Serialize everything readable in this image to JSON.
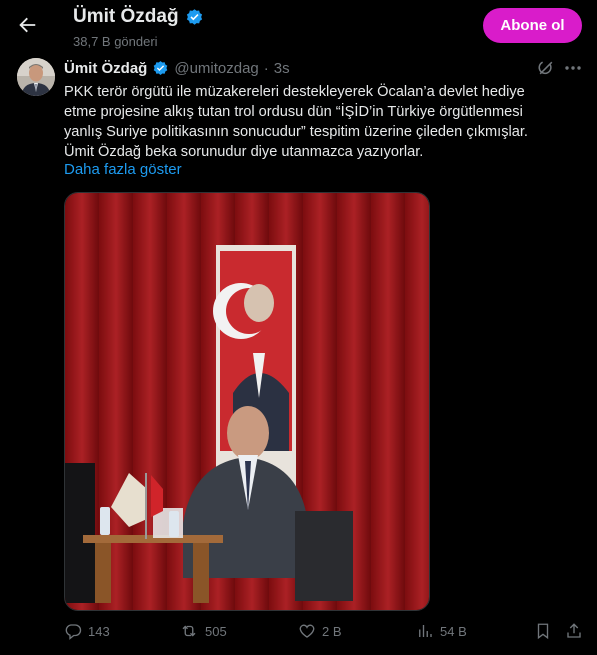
{
  "header": {
    "title": "Ümit Özdağ",
    "subtitle": "38,7 B gönderi",
    "follow_label": "Abone ol"
  },
  "tweet": {
    "author_name": "Ümit Özdağ",
    "handle": "@umitozdag",
    "separator": "·",
    "time": "3s",
    "text": "PKK terör örgütü ile müzakereleri destekleyerek Öcalan’a devlet hediye\netme projesine alkış tutan trol ordusu dün “İŞİD’in Türkiye örgütlenmesi\nyanlış Suriye politikasının sonucudur”  tespitim üzerine çileden çıkmışlar.\nÜmit Özdağ beka sorunudur diye utanmazca yazıyorlar.",
    "show_more": "Daha fazla göster"
  },
  "metrics": {
    "replies": "143",
    "reposts": "505",
    "likes": "2 B",
    "views": "54 B"
  },
  "colors": {
    "accent": "#1d9bf0",
    "follow_button": "#d91cca",
    "muted": "#71767b",
    "background": "#000000"
  },
  "icons": {
    "back": "arrow-left-icon",
    "verified": "verified-badge-icon",
    "grok": "grok-icon",
    "more": "more-horizontal-icon",
    "reply": "reply-icon",
    "repost": "repost-icon",
    "like": "like-icon",
    "views": "views-icon",
    "bookmark": "bookmark-icon",
    "share": "share-icon"
  }
}
